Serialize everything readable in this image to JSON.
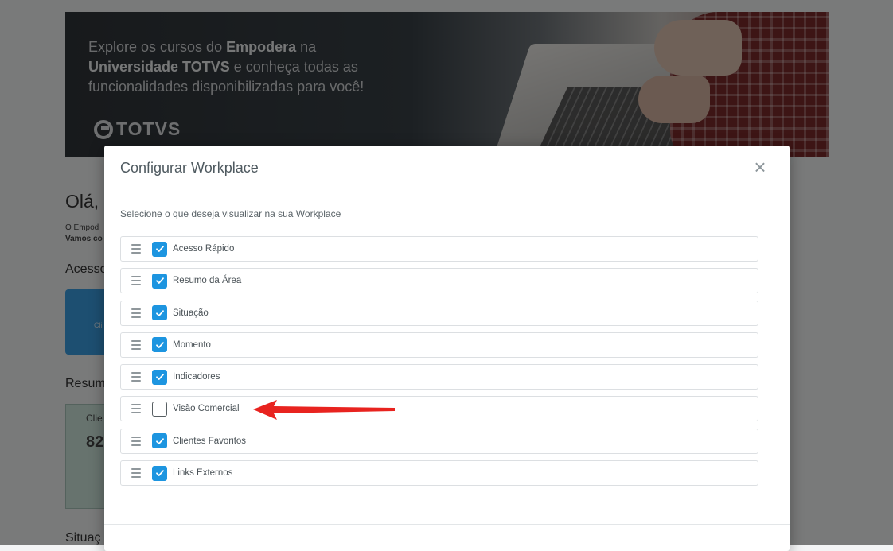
{
  "banner": {
    "line1_pre": "Explore os cursos do ",
    "line1_bold": "Empodera",
    "line1_post": " na",
    "line2_bold": "Universidade TOTVS",
    "line2_post": " e conheça todas as",
    "line3": "funcionalidades disponibilizadas para você!",
    "logo_text": "TOTVS"
  },
  "background": {
    "greeting": "Olá,",
    "text1": "O Empod",
    "text2": "Vamos co",
    "section_acesso": "Acesso",
    "card_label": "Cli",
    "section_resumo": "Resum",
    "card2_title": "Clie",
    "card2_value": "82",
    "section_situacao": "Situaç"
  },
  "modal": {
    "title": "Configurar Workplace",
    "close_label": "×",
    "subtitle": "Selecione o que deseja visualizar na sua Workplace",
    "items": [
      {
        "label": "Acesso Rápido",
        "checked": true
      },
      {
        "label": "Resumo da Área",
        "checked": true
      },
      {
        "label": "Situação",
        "checked": true
      },
      {
        "label": "Momento",
        "checked": true
      },
      {
        "label": "Indicadores",
        "checked": true
      },
      {
        "label": "Visão Comercial",
        "checked": false
      },
      {
        "label": "Clientes Favoritos",
        "checked": true
      },
      {
        "label": "Links Externos",
        "checked": true
      }
    ]
  },
  "colors": {
    "checkbox_checked": "#1d95e0",
    "annotation_arrow": "#e8231f"
  },
  "icons": {
    "drag": "drag-handle-icon",
    "check": "check-icon",
    "close": "close-icon",
    "logo": "totvs-logo-icon"
  }
}
